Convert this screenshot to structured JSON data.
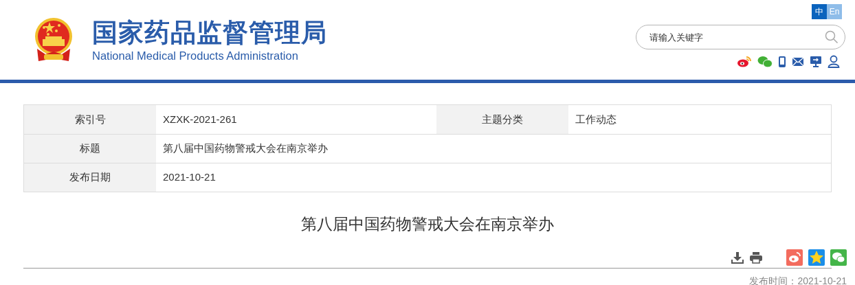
{
  "header": {
    "title": "国家药品监督管理局",
    "subtitle": "National Medical Products Administration",
    "languages": [
      {
        "label": "中",
        "selected": true
      },
      {
        "label": "En",
        "selected": false
      }
    ],
    "search": {
      "placeholder": "请输入关键字"
    }
  },
  "info_table": {
    "rows": [
      {
        "cells": [
          {
            "kind": "label",
            "text": "索引号"
          },
          {
            "kind": "value",
            "text": "XZXK-2021-261"
          },
          {
            "kind": "label",
            "text": "主题分类"
          },
          {
            "kind": "value",
            "text": "工作动态"
          }
        ]
      },
      {
        "cells": [
          {
            "kind": "label",
            "text": "标题"
          },
          {
            "kind": "value",
            "text": "第八届中国药物警戒大会在南京举办"
          }
        ]
      },
      {
        "cells": [
          {
            "kind": "label",
            "text": "发布日期"
          },
          {
            "kind": "value",
            "text": "2021-10-21"
          }
        ]
      }
    ]
  },
  "article": {
    "title": "第八届中国药物警戒大会在南京举办",
    "publish_time": "发布时间：2021-10-21"
  }
}
